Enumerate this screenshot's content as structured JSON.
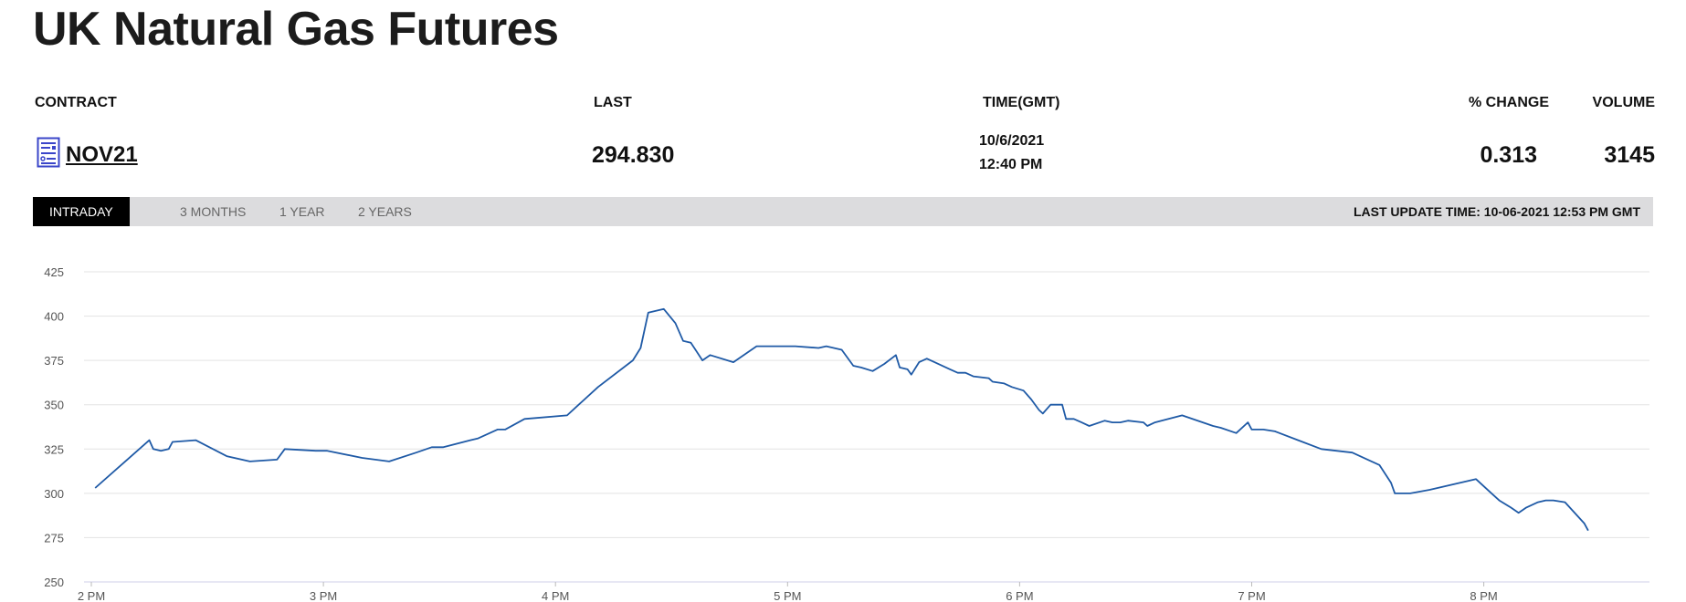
{
  "page": {
    "title": "UK Natural Gas Futures"
  },
  "headers": {
    "contract": "CONTRACT",
    "last": "LAST",
    "time": "TIME(GMT)",
    "change": "% CHANGE",
    "volume": "VOLUME"
  },
  "row": {
    "contract": "NOV21",
    "last": "294.830",
    "date": "10/6/2021",
    "time": "12:40 PM",
    "change": "0.313",
    "volume": "3145"
  },
  "tabs": [
    "INTRADAY",
    "3 MONTHS",
    "1 YEAR",
    "2 YEARS"
  ],
  "active_tab": "INTRADAY",
  "last_update": "LAST UPDATE TIME: 10-06-2021 12:53 PM GMT",
  "colors": {
    "line": "#1f5aa6",
    "grid": "#e3e3e3",
    "tab_active": "#000000",
    "tab_bar": "#dcdcde"
  },
  "chart_data": {
    "type": "line",
    "title": "",
    "xlabel": "",
    "ylabel": "",
    "ylim": [
      250,
      425
    ],
    "yticks": [
      250,
      275,
      300,
      325,
      350,
      375,
      400,
      425
    ],
    "xlim": [
      0,
      387
    ],
    "xticks": [
      {
        "x": 0,
        "label": "2 PM"
      },
      {
        "x": 60,
        "label": "3 PM"
      },
      {
        "x": 120,
        "label": "4 PM"
      },
      {
        "x": 180,
        "label": "5 PM"
      },
      {
        "x": 240,
        "label": "6 PM"
      },
      {
        "x": 300,
        "label": "7 PM"
      },
      {
        "x": 360,
        "label": "8 PM"
      }
    ],
    "grid": true,
    "series": [
      {
        "values": [
          [
            1,
            303
          ],
          [
            15,
            330
          ],
          [
            16,
            325
          ],
          [
            18,
            324
          ],
          [
            20,
            325
          ],
          [
            21,
            329
          ],
          [
            27,
            330
          ],
          [
            35,
            321
          ],
          [
            41,
            318
          ],
          [
            48,
            319
          ],
          [
            50,
            325
          ],
          [
            58,
            324
          ],
          [
            61,
            324
          ],
          [
            70,
            320
          ],
          [
            77,
            318
          ],
          [
            84,
            323
          ],
          [
            88,
            326
          ],
          [
            91,
            326
          ],
          [
            98,
            330
          ],
          [
            100,
            331
          ],
          [
            105,
            336
          ],
          [
            107,
            336
          ],
          [
            112,
            342
          ],
          [
            123,
            344
          ],
          [
            126,
            350
          ],
          [
            131,
            360
          ],
          [
            140,
            375
          ],
          [
            142,
            382
          ],
          [
            144,
            402
          ],
          [
            148,
            404
          ],
          [
            151,
            396
          ],
          [
            153,
            386
          ],
          [
            155,
            385
          ],
          [
            158,
            375
          ],
          [
            160,
            378
          ],
          [
            166,
            374
          ],
          [
            172,
            383
          ],
          [
            182,
            383
          ],
          [
            188,
            382
          ],
          [
            190,
            383
          ],
          [
            194,
            381
          ],
          [
            197,
            372
          ],
          [
            199,
            371
          ],
          [
            202,
            369
          ],
          [
            205,
            373
          ],
          [
            208,
            378
          ],
          [
            209,
            371
          ],
          [
            211,
            370
          ],
          [
            212,
            367
          ],
          [
            214,
            374
          ],
          [
            216,
            376
          ],
          [
            218,
            374
          ],
          [
            222,
            370
          ],
          [
            224,
            368
          ],
          [
            226,
            368
          ],
          [
            228,
            366
          ],
          [
            232,
            365
          ],
          [
            233,
            363
          ],
          [
            236,
            362
          ],
          [
            238,
            360
          ],
          [
            241,
            358
          ],
          [
            243,
            353
          ],
          [
            245,
            347
          ],
          [
            246,
            345
          ],
          [
            248,
            350
          ],
          [
            251,
            350
          ],
          [
            252,
            342
          ],
          [
            254,
            342
          ],
          [
            256,
            340
          ],
          [
            258,
            338
          ],
          [
            262,
            341
          ],
          [
            264,
            340
          ],
          [
            266,
            340
          ],
          [
            268,
            341
          ],
          [
            272,
            340
          ],
          [
            273,
            338
          ],
          [
            275,
            340
          ],
          [
            282,
            344
          ],
          [
            290,
            338
          ],
          [
            292,
            337
          ],
          [
            296,
            334
          ],
          [
            299,
            340
          ],
          [
            300,
            336
          ],
          [
            303,
            336
          ],
          [
            306,
            335
          ],
          [
            312,
            330
          ],
          [
            318,
            325
          ],
          [
            326,
            323
          ],
          [
            331,
            318
          ],
          [
            333,
            316
          ],
          [
            336,
            306
          ],
          [
            337,
            300
          ],
          [
            341,
            300
          ],
          [
            346,
            302
          ],
          [
            358,
            308
          ],
          [
            362,
            300
          ],
          [
            364,
            296
          ],
          [
            367,
            292
          ],
          [
            369,
            289
          ],
          [
            371,
            292
          ],
          [
            374,
            295
          ],
          [
            376,
            296
          ],
          [
            378,
            296
          ],
          [
            381,
            295
          ],
          [
            386,
            283
          ],
          [
            387,
            279
          ]
        ]
      }
    ]
  }
}
